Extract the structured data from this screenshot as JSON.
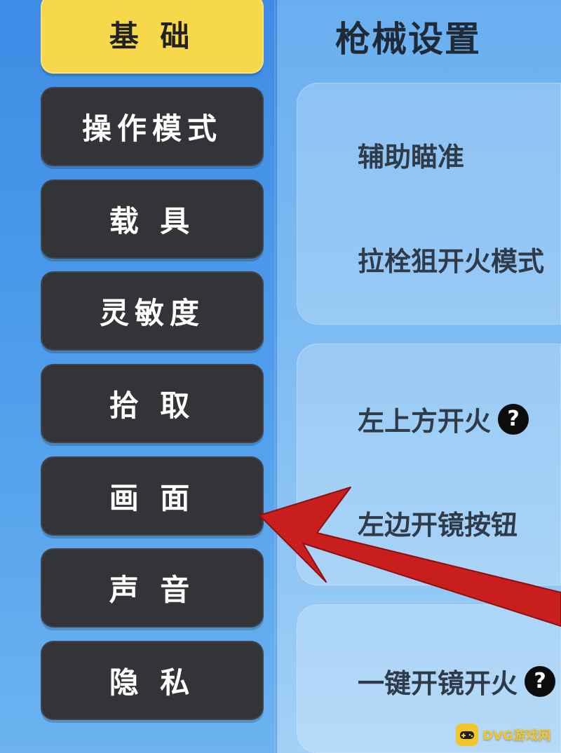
{
  "sidebar": {
    "items": [
      {
        "label": "基 础",
        "active": true
      },
      {
        "label": "操作模式",
        "active": false
      },
      {
        "label": "载 具",
        "active": false
      },
      {
        "label": "灵敏度",
        "active": false
      },
      {
        "label": "拾 取",
        "active": false
      },
      {
        "label": "画 面",
        "active": false
      },
      {
        "label": "声 音",
        "active": false
      },
      {
        "label": "隐 私",
        "active": false
      }
    ]
  },
  "main": {
    "title": "枪械设置",
    "groups": [
      {
        "settings": [
          {
            "label": "辅助瞄准"
          },
          {
            "label": "拉栓狙开火模式"
          }
        ]
      },
      {
        "settings": [
          {
            "label": "左上方开火",
            "help_icon": "?"
          },
          {
            "label": "左边开镜按钮"
          }
        ]
      },
      {
        "settings": [
          {
            "label": "一键开镜开火",
            "help_icon": "?"
          }
        ]
      }
    ]
  },
  "annotation": {
    "arrow_color": "#c81e1e",
    "points_to": "画 面"
  },
  "watermark": {
    "text": "DVG游戏网"
  },
  "colors": {
    "active": "#f7d84a",
    "inactive": "#333438"
  }
}
